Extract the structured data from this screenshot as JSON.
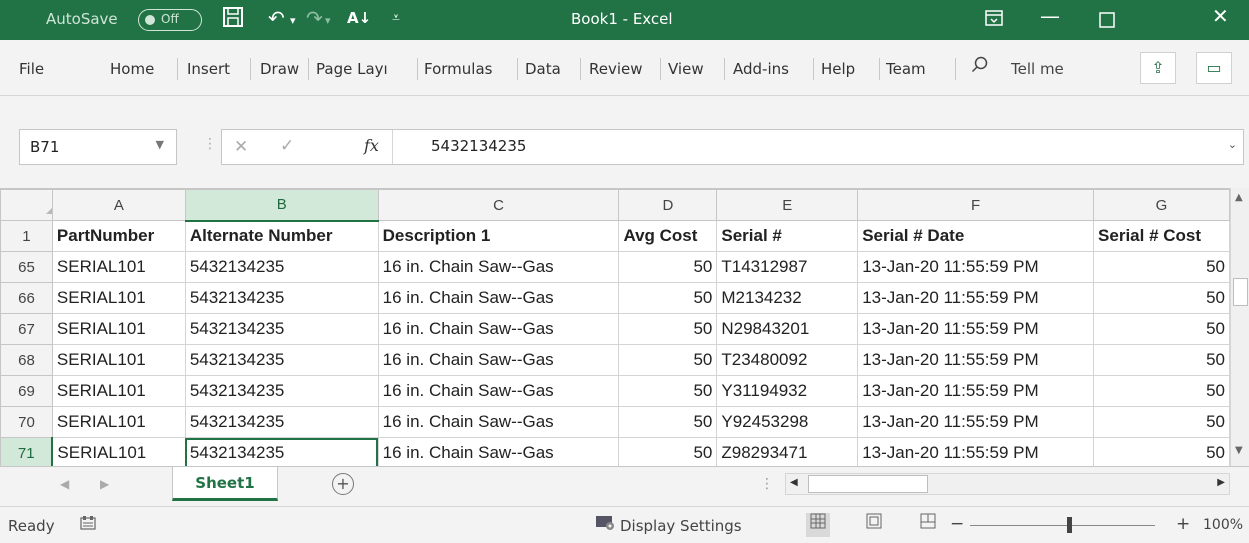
{
  "titlebar": {
    "autosave_label": "AutoSave",
    "autosave_state": "Off",
    "title": "Book1 - Excel"
  },
  "ribbon": {
    "tabs": [
      "File",
      "Home",
      "Insert",
      "Draw",
      "Page Layı",
      "Formulas",
      "Data",
      "Review",
      "View",
      "Add-ins",
      "Help",
      "Team"
    ],
    "tell_me": "Tell me"
  },
  "formula_bar": {
    "name_box": "B71",
    "fx": "fx",
    "value": "5432134235"
  },
  "grid": {
    "columns": [
      "A",
      "B",
      "C",
      "D",
      "E",
      "F",
      "G"
    ],
    "selected_column": "B",
    "header_row": {
      "num": "1",
      "cells": [
        "PartNumber",
        "Alternate Number",
        "Description 1",
        "Avg Cost",
        "Serial #",
        "Serial # Date",
        "Serial # Cost"
      ]
    },
    "rows": [
      {
        "num": "65",
        "cells": [
          "SERIAL101",
          "5432134235",
          "16 in. Chain Saw--Gas",
          "50",
          "T14312987",
          "13-Jan-20 11:55:59 PM",
          "50"
        ]
      },
      {
        "num": "66",
        "cells": [
          "SERIAL101",
          "5432134235",
          "16 in. Chain Saw--Gas",
          "50",
          "M2134232",
          "13-Jan-20 11:55:59 PM",
          "50"
        ]
      },
      {
        "num": "67",
        "cells": [
          "SERIAL101",
          "5432134235",
          "16 in. Chain Saw--Gas",
          "50",
          "N29843201",
          "13-Jan-20 11:55:59 PM",
          "50"
        ]
      },
      {
        "num": "68",
        "cells": [
          "SERIAL101",
          "5432134235",
          "16 in. Chain Saw--Gas",
          "50",
          "T23480092",
          "13-Jan-20 11:55:59 PM",
          "50"
        ]
      },
      {
        "num": "69",
        "cells": [
          "SERIAL101",
          "5432134235",
          "16 in. Chain Saw--Gas",
          "50",
          "Y31194932",
          "13-Jan-20 11:55:59 PM",
          "50"
        ]
      },
      {
        "num": "70",
        "cells": [
          "SERIAL101",
          "5432134235",
          "16 in. Chain Saw--Gas",
          "50",
          "Y92453298",
          "13-Jan-20 11:55:59 PM",
          "50"
        ]
      },
      {
        "num": "71",
        "cells": [
          "SERIAL101",
          "5432134235",
          "16 in. Chain Saw--Gas",
          "50",
          "Z98293471",
          "13-Jan-20 11:55:59 PM",
          "50"
        ]
      }
    ],
    "active_cell": "B71"
  },
  "sheets": {
    "tabs": [
      "Sheet1"
    ]
  },
  "status": {
    "ready": "Ready",
    "display_settings": "Display Settings",
    "zoom": "100%"
  },
  "colors": {
    "accent": "#217346"
  }
}
